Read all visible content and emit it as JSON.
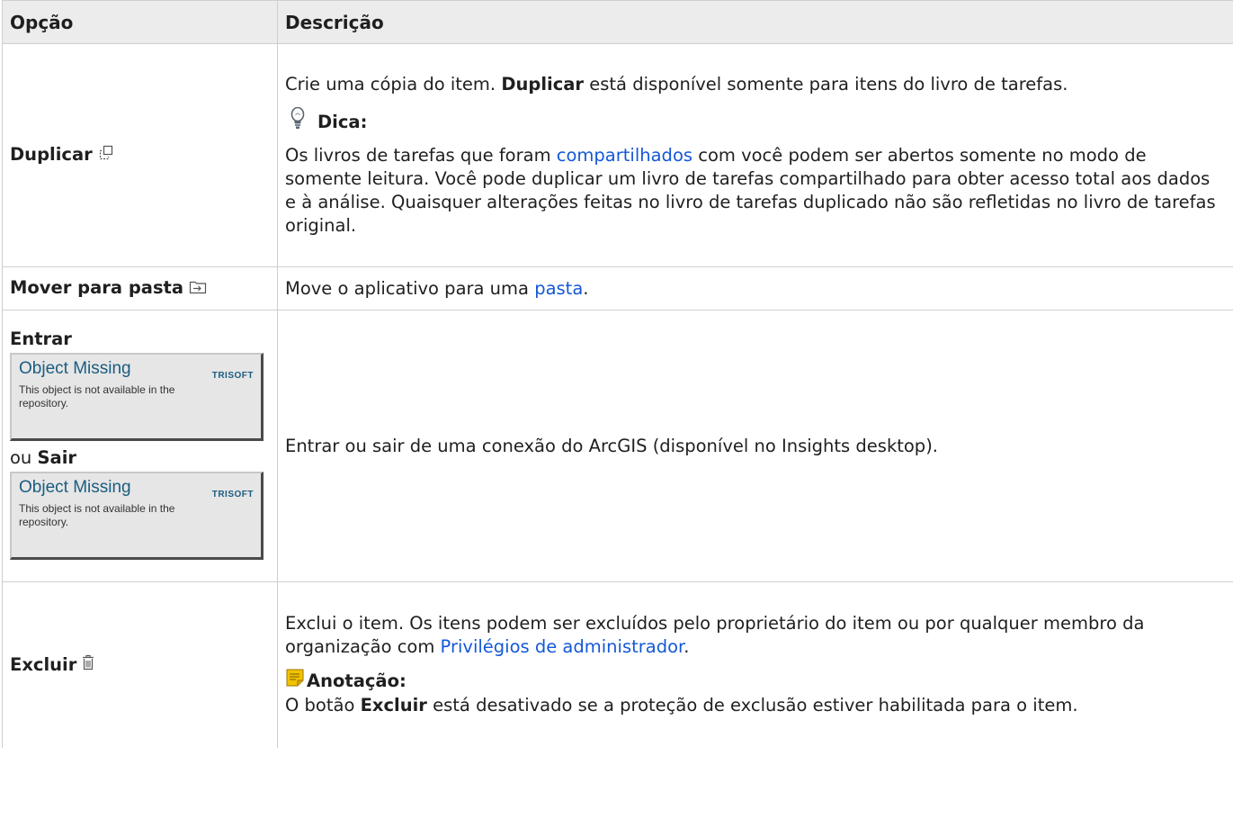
{
  "table": {
    "headers": [
      "Opção",
      "Descrição"
    ]
  },
  "rows": {
    "duplicate": {
      "label": "Duplicar",
      "desc_pre": "Crie uma cópia do item. ",
      "desc_bold": "Duplicar",
      "desc_post": " está disponível somente para itens do livro de tarefas.",
      "tip_title": "Dica:",
      "tip_pre": "Os livros de tarefas que foram ",
      "tip_link": "compartilhados",
      "tip_post": " com você podem ser abertos somente no modo de somente leitura. Você pode duplicar um livro de tarefas compartilhado para obter acesso total aos dados e à análise. Quaisquer alterações feitas no livro de tarefas duplicado não são refletidas no livro de tarefas original."
    },
    "move": {
      "label": "Mover para pasta",
      "desc_pre": "Move o aplicativo para uma ",
      "desc_link": "pasta",
      "desc_post": "."
    },
    "signin": {
      "label_in": "Entrar",
      "label_or": "ou ",
      "label_out": "Sair",
      "missing_title": "Object Missing",
      "missing_brand": "TRISOFT",
      "missing_text": "This object is not available in the repository.",
      "desc": "Entrar ou sair de uma conexão do ArcGIS (disponível no Insights desktop)."
    },
    "delete": {
      "label": "Excluir",
      "desc_pre": "Exclui o item. Os itens podem ser excluídos pelo proprietário do item ou por qualquer membro da organização com ",
      "desc_link": "Privilégios de administrador",
      "desc_post": ".",
      "note_title": "Anotação:",
      "note_pre": "O botão ",
      "note_bold": "Excluir",
      "note_post": " está desativado se a proteção de exclusão estiver habilitada para o item."
    }
  },
  "icons": {
    "duplicate": "duplicate-icon",
    "move": "move-to-folder-icon",
    "delete": "trash-icon",
    "tip": "lightbulb-icon",
    "note": "note-icon"
  },
  "colors": {
    "link": "#1458d6",
    "header_bg": "#ececec",
    "missing_title": "#1a5d80"
  }
}
